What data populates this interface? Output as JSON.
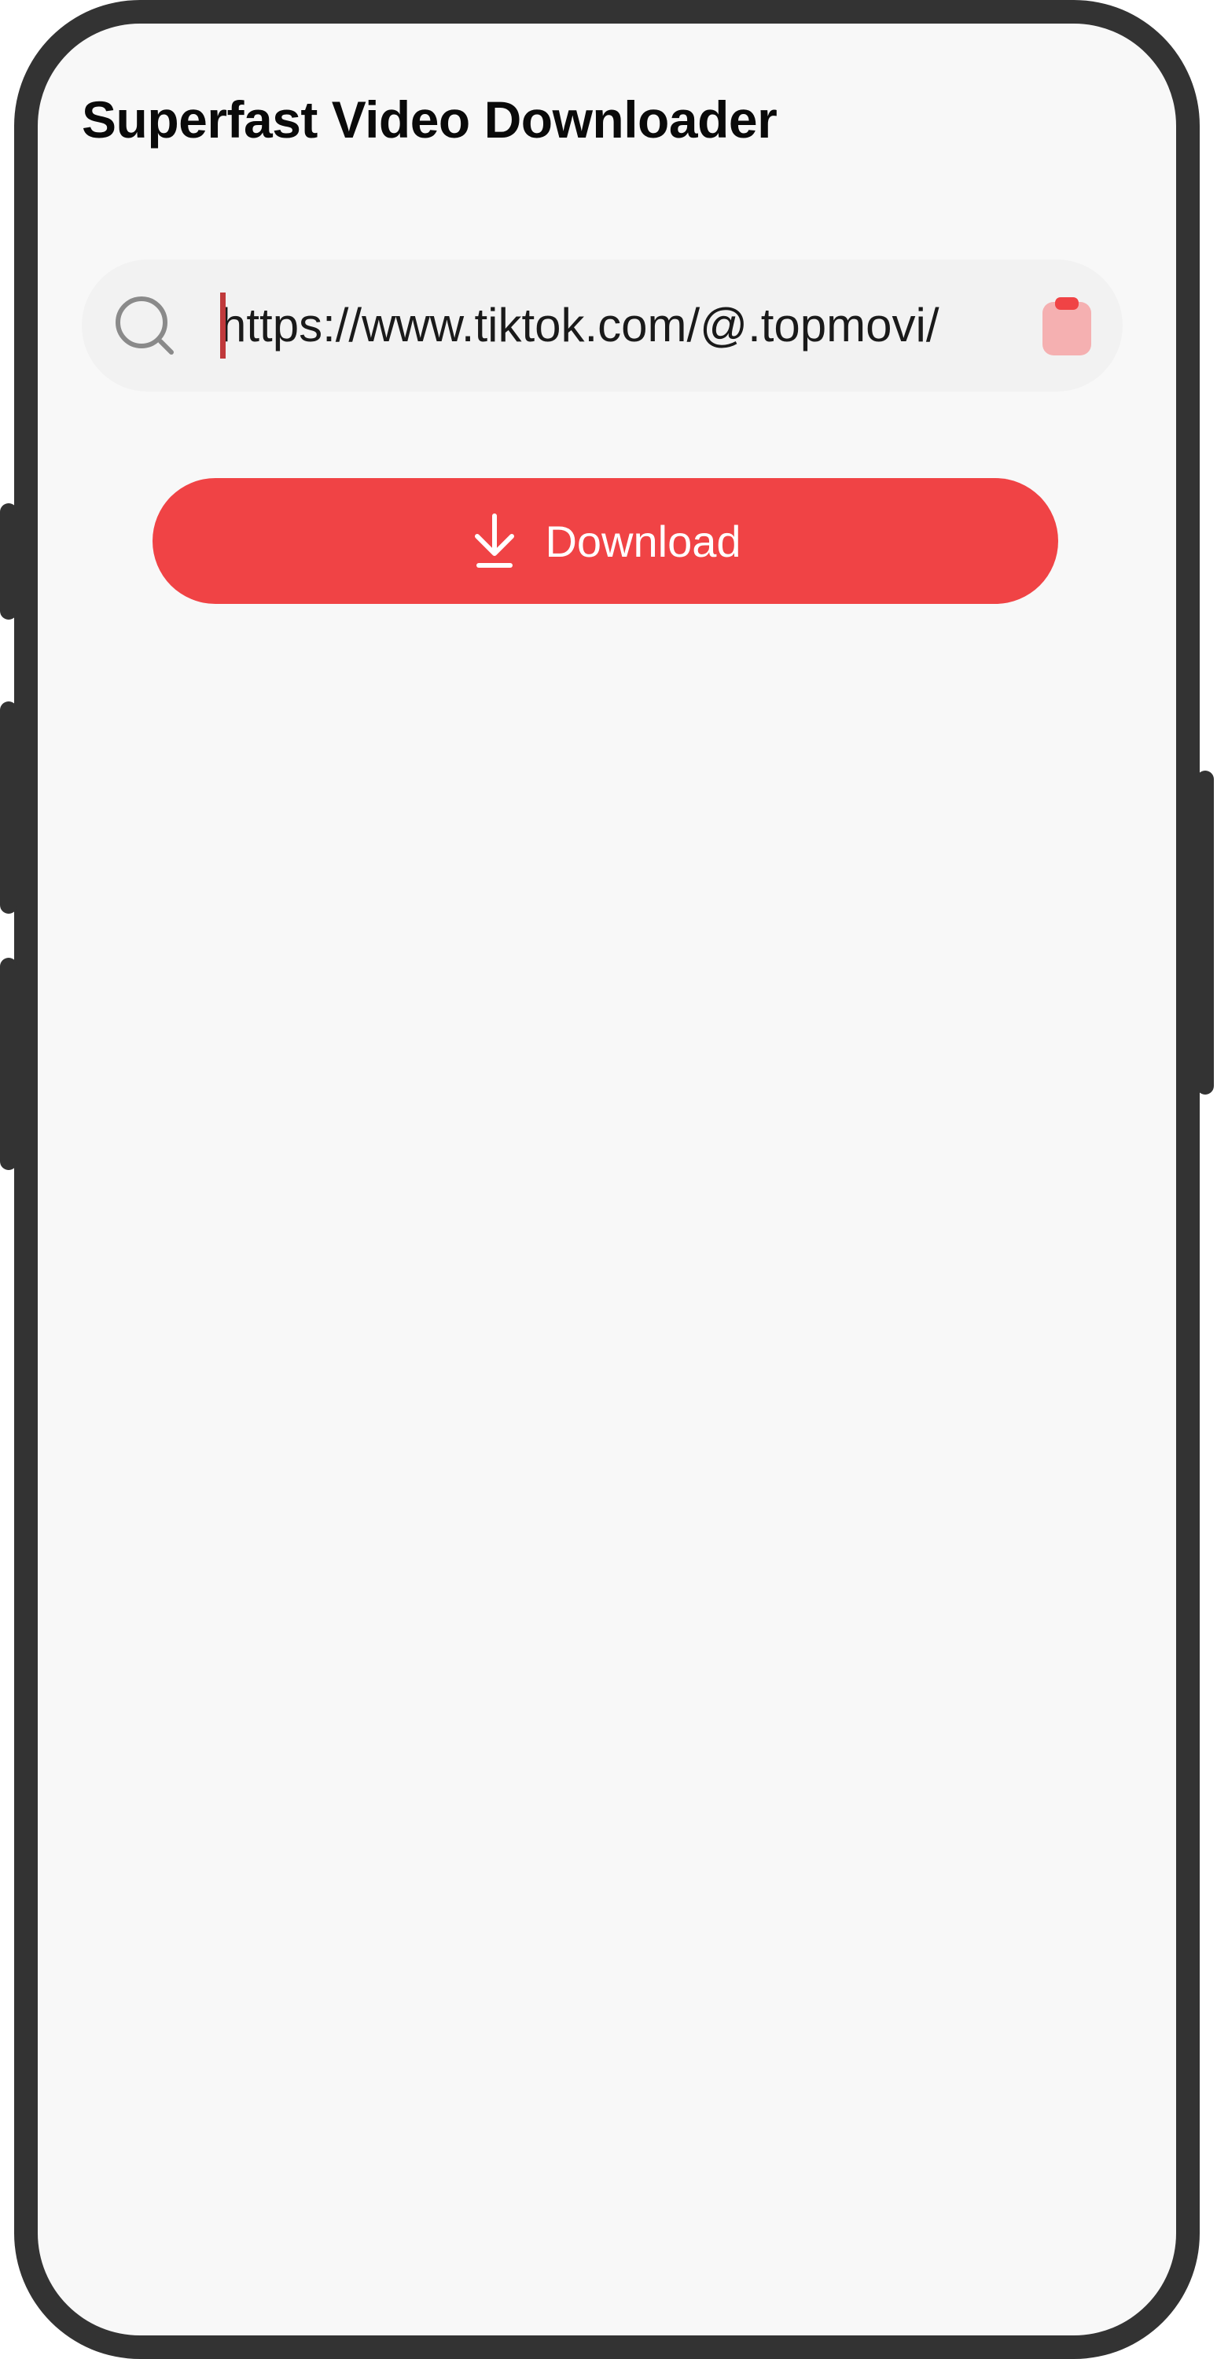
{
  "app": {
    "title": "Superfast Video Downloader"
  },
  "search": {
    "value": "https://www.tiktok.com/@.topmovi/",
    "icon": "search-icon"
  },
  "paste": {
    "icon": "clipboard-paste-icon",
    "color": "#f5b0b1",
    "accent": "#f04345"
  },
  "download_button": {
    "label": "Download",
    "icon": "download-icon",
    "color": "#f04345"
  },
  "theme": {
    "background": "#f8f8f8",
    "frame": "#333333",
    "accent": "#f04345"
  }
}
